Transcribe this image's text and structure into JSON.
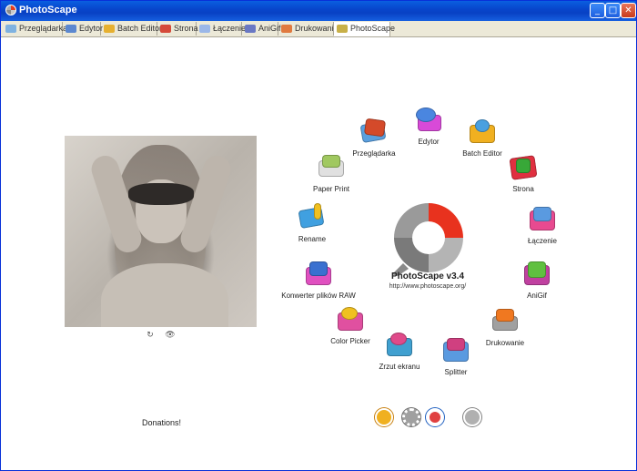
{
  "window": {
    "title": "PhotoScape"
  },
  "titlebar_buttons": {
    "minimize": "_",
    "maximize": "□",
    "close": "✕"
  },
  "tabs": [
    {
      "label": "Przeglądarka",
      "icon": "browser-icon",
      "color": "#7fb2e0"
    },
    {
      "label": "Edytor",
      "icon": "editor-icon",
      "color": "#5c88d0"
    },
    {
      "label": "Batch Editor",
      "icon": "batch-icon",
      "color": "#e6b030"
    },
    {
      "label": "Strona",
      "icon": "page-icon",
      "color": "#d54a3a"
    },
    {
      "label": "Łączenie",
      "icon": "combine-icon",
      "color": "#9bb7e8"
    },
    {
      "label": "AniGif",
      "icon": "anigif-icon",
      "color": "#6a78c4"
    },
    {
      "label": "Drukowanie",
      "icon": "print-icon",
      "color": "#e07a40"
    },
    {
      "label": "PhotoScape",
      "icon": "photoscape-icon",
      "color": "#c8b048",
      "active": true
    }
  ],
  "photo": {
    "controls": [
      "↻",
      "👁"
    ]
  },
  "center": {
    "product": "PhotoScape v3.4",
    "url": "http://www.photoscape.org/"
  },
  "tools": [
    {
      "label": "Przeglądarka",
      "icon": "browser-icon",
      "colors": [
        "#d44a2a",
        "#5aa0e0"
      ]
    },
    {
      "label": "Edytor",
      "icon": "editor-icon",
      "colors": [
        "#d84ad8",
        "#4a86e0"
      ]
    },
    {
      "label": "Batch Editor",
      "icon": "batch-editor-icon",
      "colors": [
        "#f0b020",
        "#4aa0e0"
      ]
    },
    {
      "label": "Strona",
      "icon": "page-icon",
      "colors": [
        "#e03040",
        "#38a838"
      ]
    },
    {
      "label": "Łączenie",
      "icon": "combine-icon",
      "colors": [
        "#e84a90",
        "#5a9ae0"
      ]
    },
    {
      "label": "AniGif",
      "icon": "anigif-icon",
      "colors": [
        "#60c040",
        "#c040a0"
      ]
    },
    {
      "label": "Drukowanie",
      "icon": "print-icon",
      "colors": [
        "#f07820",
        "#a0a0a0"
      ]
    },
    {
      "label": "Splitter",
      "icon": "splitter-icon",
      "colors": [
        "#d04080",
        "#5a9ae0"
      ]
    },
    {
      "label": "Zrzut ekranu",
      "icon": "screenshot-icon",
      "colors": [
        "#e04a8a",
        "#40a0d0"
      ]
    },
    {
      "label": "Color Picker",
      "icon": "color-picker-icon",
      "colors": [
        "#f0c020",
        "#e050a0"
      ]
    },
    {
      "label": "Konwerter plików RAW",
      "icon": "raw-converter-icon",
      "colors": [
        "#e050c0",
        "#3a70d0"
      ]
    },
    {
      "label": "Rename",
      "icon": "rename-icon",
      "colors": [
        "#40a0e0",
        "#f0c020"
      ]
    },
    {
      "label": "Paper Print",
      "icon": "paper-print-icon",
      "colors": [
        "#a0c860",
        "#e0e0e0"
      ]
    }
  ],
  "bottom_icons": [
    {
      "icon": "help-icon",
      "color": "#f0b020"
    },
    {
      "icon": "settings-icon",
      "color": "#a0a0a0"
    },
    {
      "icon": "community-icon",
      "color": "#e04040"
    },
    {
      "icon": "about-icon",
      "color": "#b0b0b0"
    }
  ],
  "donations_label": "Donations!"
}
